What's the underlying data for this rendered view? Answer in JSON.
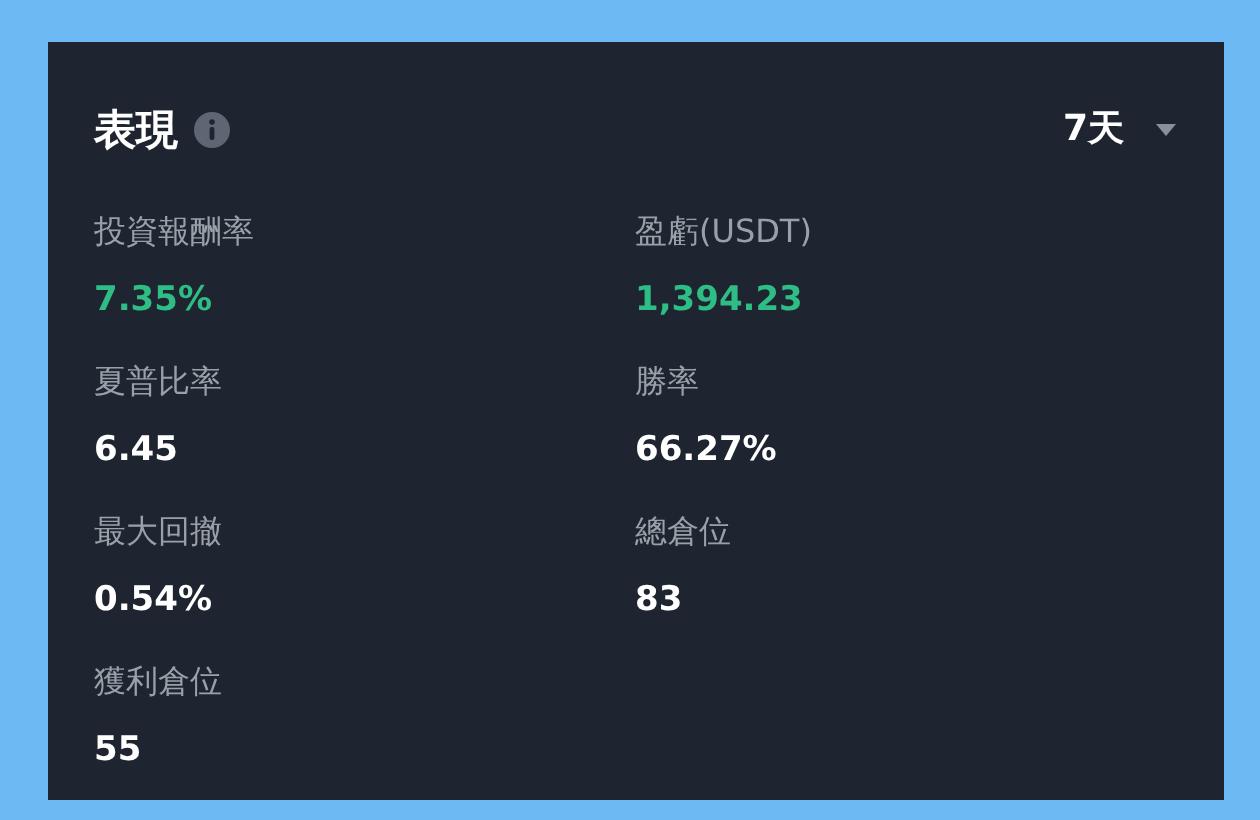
{
  "card": {
    "title": "表現",
    "period": "7天"
  },
  "metrics": [
    {
      "label": "投資報酬率",
      "value": "7.35%",
      "positive": true
    },
    {
      "label": "盈虧(USDT)",
      "value": "1,394.23",
      "positive": true
    },
    {
      "label": "夏普比率",
      "value": "6.45",
      "positive": false
    },
    {
      "label": "勝率",
      "value": "66.27%",
      "positive": false
    },
    {
      "label": "最大回撤",
      "value": "0.54%",
      "positive": false
    },
    {
      "label": "總倉位",
      "value": "83",
      "positive": false
    },
    {
      "label": "獲利倉位",
      "value": "55",
      "positive": false
    }
  ]
}
